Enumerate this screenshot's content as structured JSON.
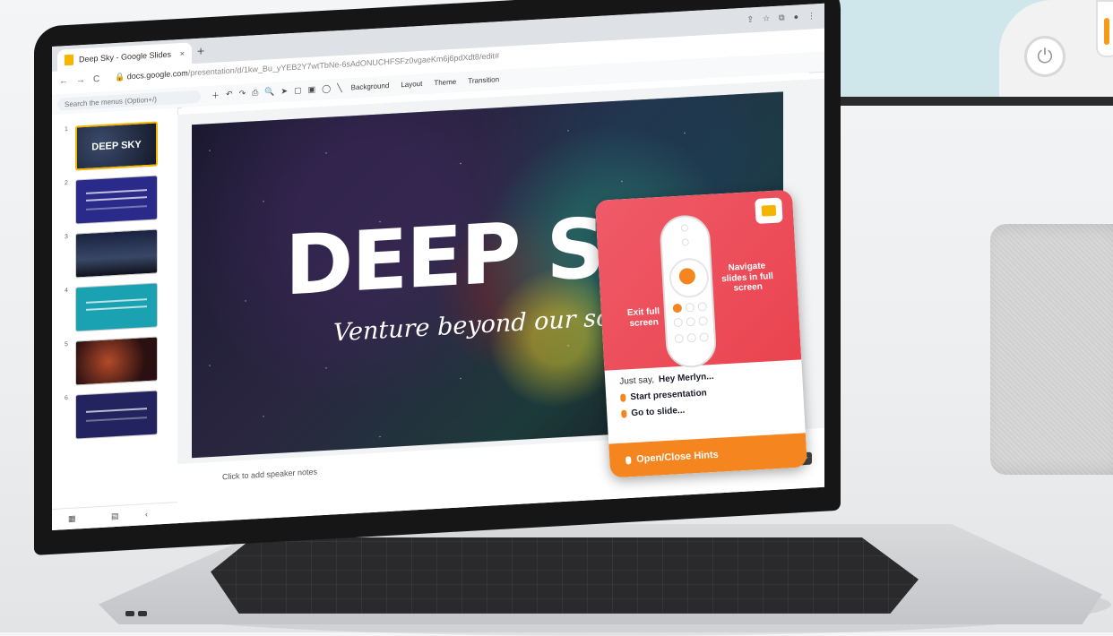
{
  "browser": {
    "tab_title": "Deep Sky - Google Slides",
    "tab_close": "×",
    "new_tab": "+",
    "url_host": "docs.google.com",
    "url_path": "/presentation/d/1kw_Bu_yYEB2Y7wtTbNe-6sAdONUCHFSFz0vgaeKm6j6pdXdt8/edit#",
    "nav": [
      "←",
      "→",
      "C"
    ]
  },
  "toolbar": {
    "search_placeholder": "Search the menus (Option+/)",
    "background": "Background",
    "layout": "Layout",
    "theme": "Theme",
    "transition": "Transition"
  },
  "filmstrip": {
    "slides": [
      {
        "num": "1",
        "title": "DEEP SKY"
      },
      {
        "num": "2",
        "title": ""
      },
      {
        "num": "3",
        "title": ""
      },
      {
        "num": "4",
        "title": ""
      },
      {
        "num": "5",
        "title": ""
      },
      {
        "num": "6",
        "title": ""
      }
    ]
  },
  "slide": {
    "title": "DEEP SKY",
    "subtitle": "Venture beyond our solar system"
  },
  "notes": {
    "placeholder": "Click to add speaker notes"
  },
  "merlyn_popup": {
    "navigate_label": "Navigate slides in full screen",
    "exit_label": "Exit full screen",
    "intro": "Just say,",
    "wake_word": "Hey Merlyn...",
    "commands": [
      "Start presentation",
      "Go to slide..."
    ],
    "button": "Open/Close Hints",
    "accent_color": "#f5861f",
    "card_color": "#e9444f"
  },
  "icons": [
    "power-icon",
    "slides-favicon-icon",
    "mic-icon",
    "remote-icon"
  ]
}
